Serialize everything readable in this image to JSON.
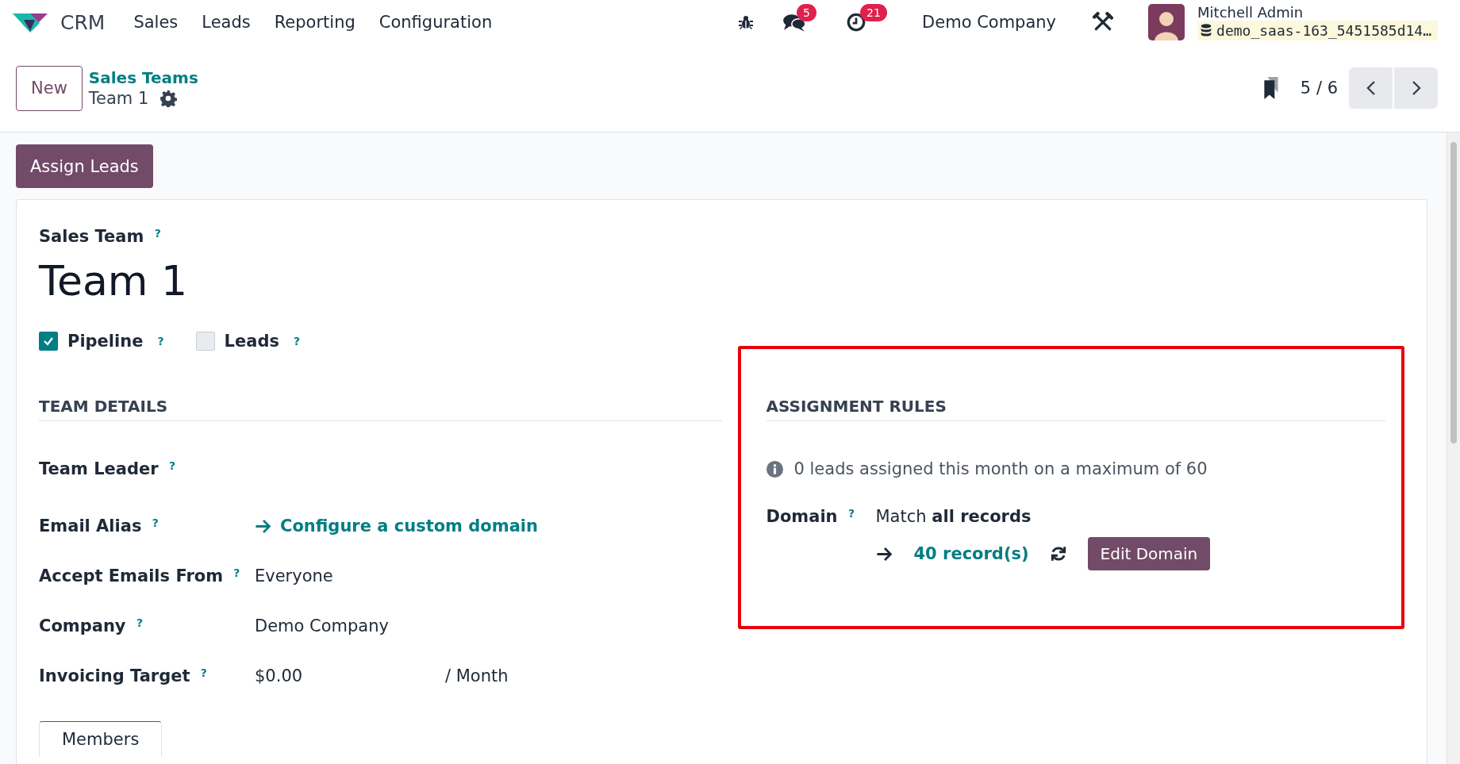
{
  "navbar": {
    "app_name": "CRM",
    "menu": [
      "Sales",
      "Leads",
      "Reporting",
      "Configuration"
    ],
    "messages_badge": "5",
    "activities_badge": "21",
    "company": "Demo Company",
    "user_name": "Mitchell Admin",
    "database": "demo_saas-163_5451585d14…"
  },
  "control_panel": {
    "new_button": "New",
    "breadcrumb": "Sales Teams",
    "record_name": "Team 1",
    "pager": "5 / 6"
  },
  "actions": [
    "Assign Leads"
  ],
  "form": {
    "title_label": "Sales Team",
    "title_help": "?",
    "name": "Team 1",
    "options": [
      {
        "label": "Pipeline",
        "help": "?",
        "checked": true
      },
      {
        "label": "Leads",
        "help": "?",
        "checked": false
      }
    ],
    "team_details": {
      "heading": "TEAM DETAILS",
      "fields": [
        {
          "kind": "empty",
          "label": "Team Leader",
          "help": "?"
        },
        {
          "kind": "link",
          "label": "Email Alias",
          "help": "?",
          "value": "Configure a custom domain"
        },
        {
          "kind": "text",
          "label": "Accept Emails From",
          "help": "?",
          "value": "Everyone"
        },
        {
          "kind": "text",
          "label": "Company",
          "help": "?",
          "value": "Demo Company"
        },
        {
          "kind": "amount",
          "label": "Invoicing Target",
          "help": "?",
          "value": "$0.00",
          "suffix": "/ Month"
        }
      ]
    },
    "assignment_rules": {
      "heading": "ASSIGNMENT RULES",
      "highlighted": true,
      "info": "0 leads assigned this month on a maximum of 60",
      "domain_label": "Domain",
      "domain_help": "?",
      "domain_text": "Match **all records**",
      "records_link": "40 record(s)",
      "edit_button": "Edit Domain"
    },
    "tabs": [
      {
        "label": "Members",
        "selected": true
      }
    ]
  }
}
